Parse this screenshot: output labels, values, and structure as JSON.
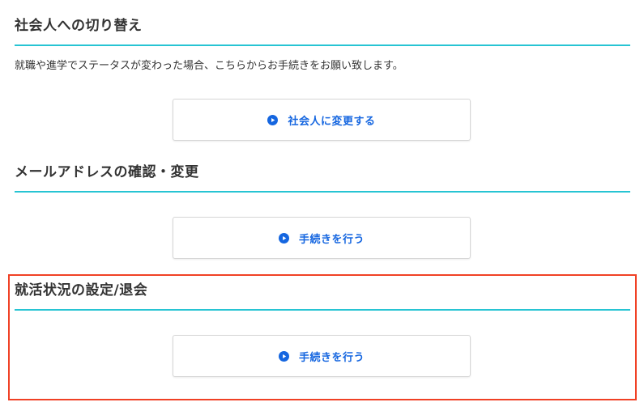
{
  "sections": [
    {
      "title": "社会人への切り替え",
      "description": "就職や進学でステータスが変わった場合、こちらからお手続きをお願い致します。",
      "button": {
        "label": "社会人に変更する",
        "icon": "play-circle-icon"
      }
    },
    {
      "title": "メールアドレスの確認・変更",
      "button": {
        "label": "手続きを行う",
        "icon": "play-circle-icon"
      }
    },
    {
      "title": "就活状況の設定/退会",
      "button": {
        "label": "手続きを行う",
        "icon": "play-circle-icon"
      }
    }
  ],
  "colors": {
    "accent_rule": "#27c4d3",
    "link_blue": "#1566e0",
    "highlight_red": "#f04125"
  }
}
